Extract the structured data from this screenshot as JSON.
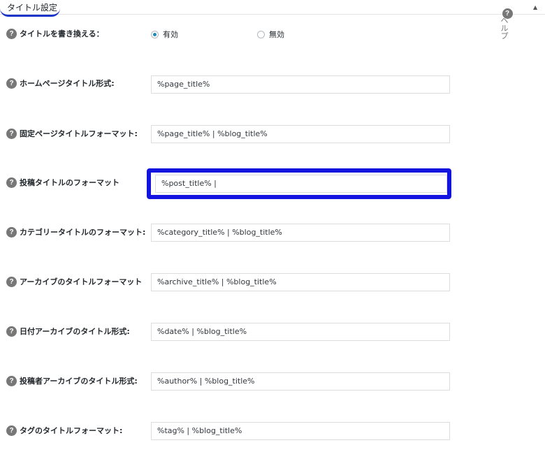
{
  "header": {
    "title": "タイトル設定",
    "help_label": "ヘルプ",
    "help_icon": "question-circle-icon",
    "collapse_icon": "triangle-up-icon"
  },
  "rewrite": {
    "label": "タイトルを書き換える：",
    "options": [
      {
        "label": "有効",
        "checked": true
      },
      {
        "label": "無効",
        "checked": false
      }
    ]
  },
  "rows": [
    {
      "label": "ホームページタイトル形式:",
      "value": "%page_title%"
    },
    {
      "label": "固定ページタイトルフォーマット:",
      "value": "%page_title% | %blog_title%"
    },
    {
      "label": "投稿タイトルのフォーマット",
      "value": "%post_title% |"
    },
    {
      "label": "カテゴリータイトルのフォーマット:",
      "value": "%category_title% | %blog_title%"
    },
    {
      "label": "アーカイブのタイトルフォーマット",
      "value": "%archive_title% | %blog_title%"
    },
    {
      "label": "日付アーカイブのタイトル形式:",
      "value": "%date% | %blog_title%"
    },
    {
      "label": "投稿者アーカイブのタイトル形式:",
      "value": "%author% | %blog_title%"
    },
    {
      "label": "タグのタイトルフォーマット:",
      "value": "%tag% | %blog_title%"
    }
  ],
  "colors": {
    "accent": "#1e8cbe",
    "highlight_border": "#1414e0",
    "header_underline": "#1a33c9",
    "help_icon": "#777777"
  }
}
